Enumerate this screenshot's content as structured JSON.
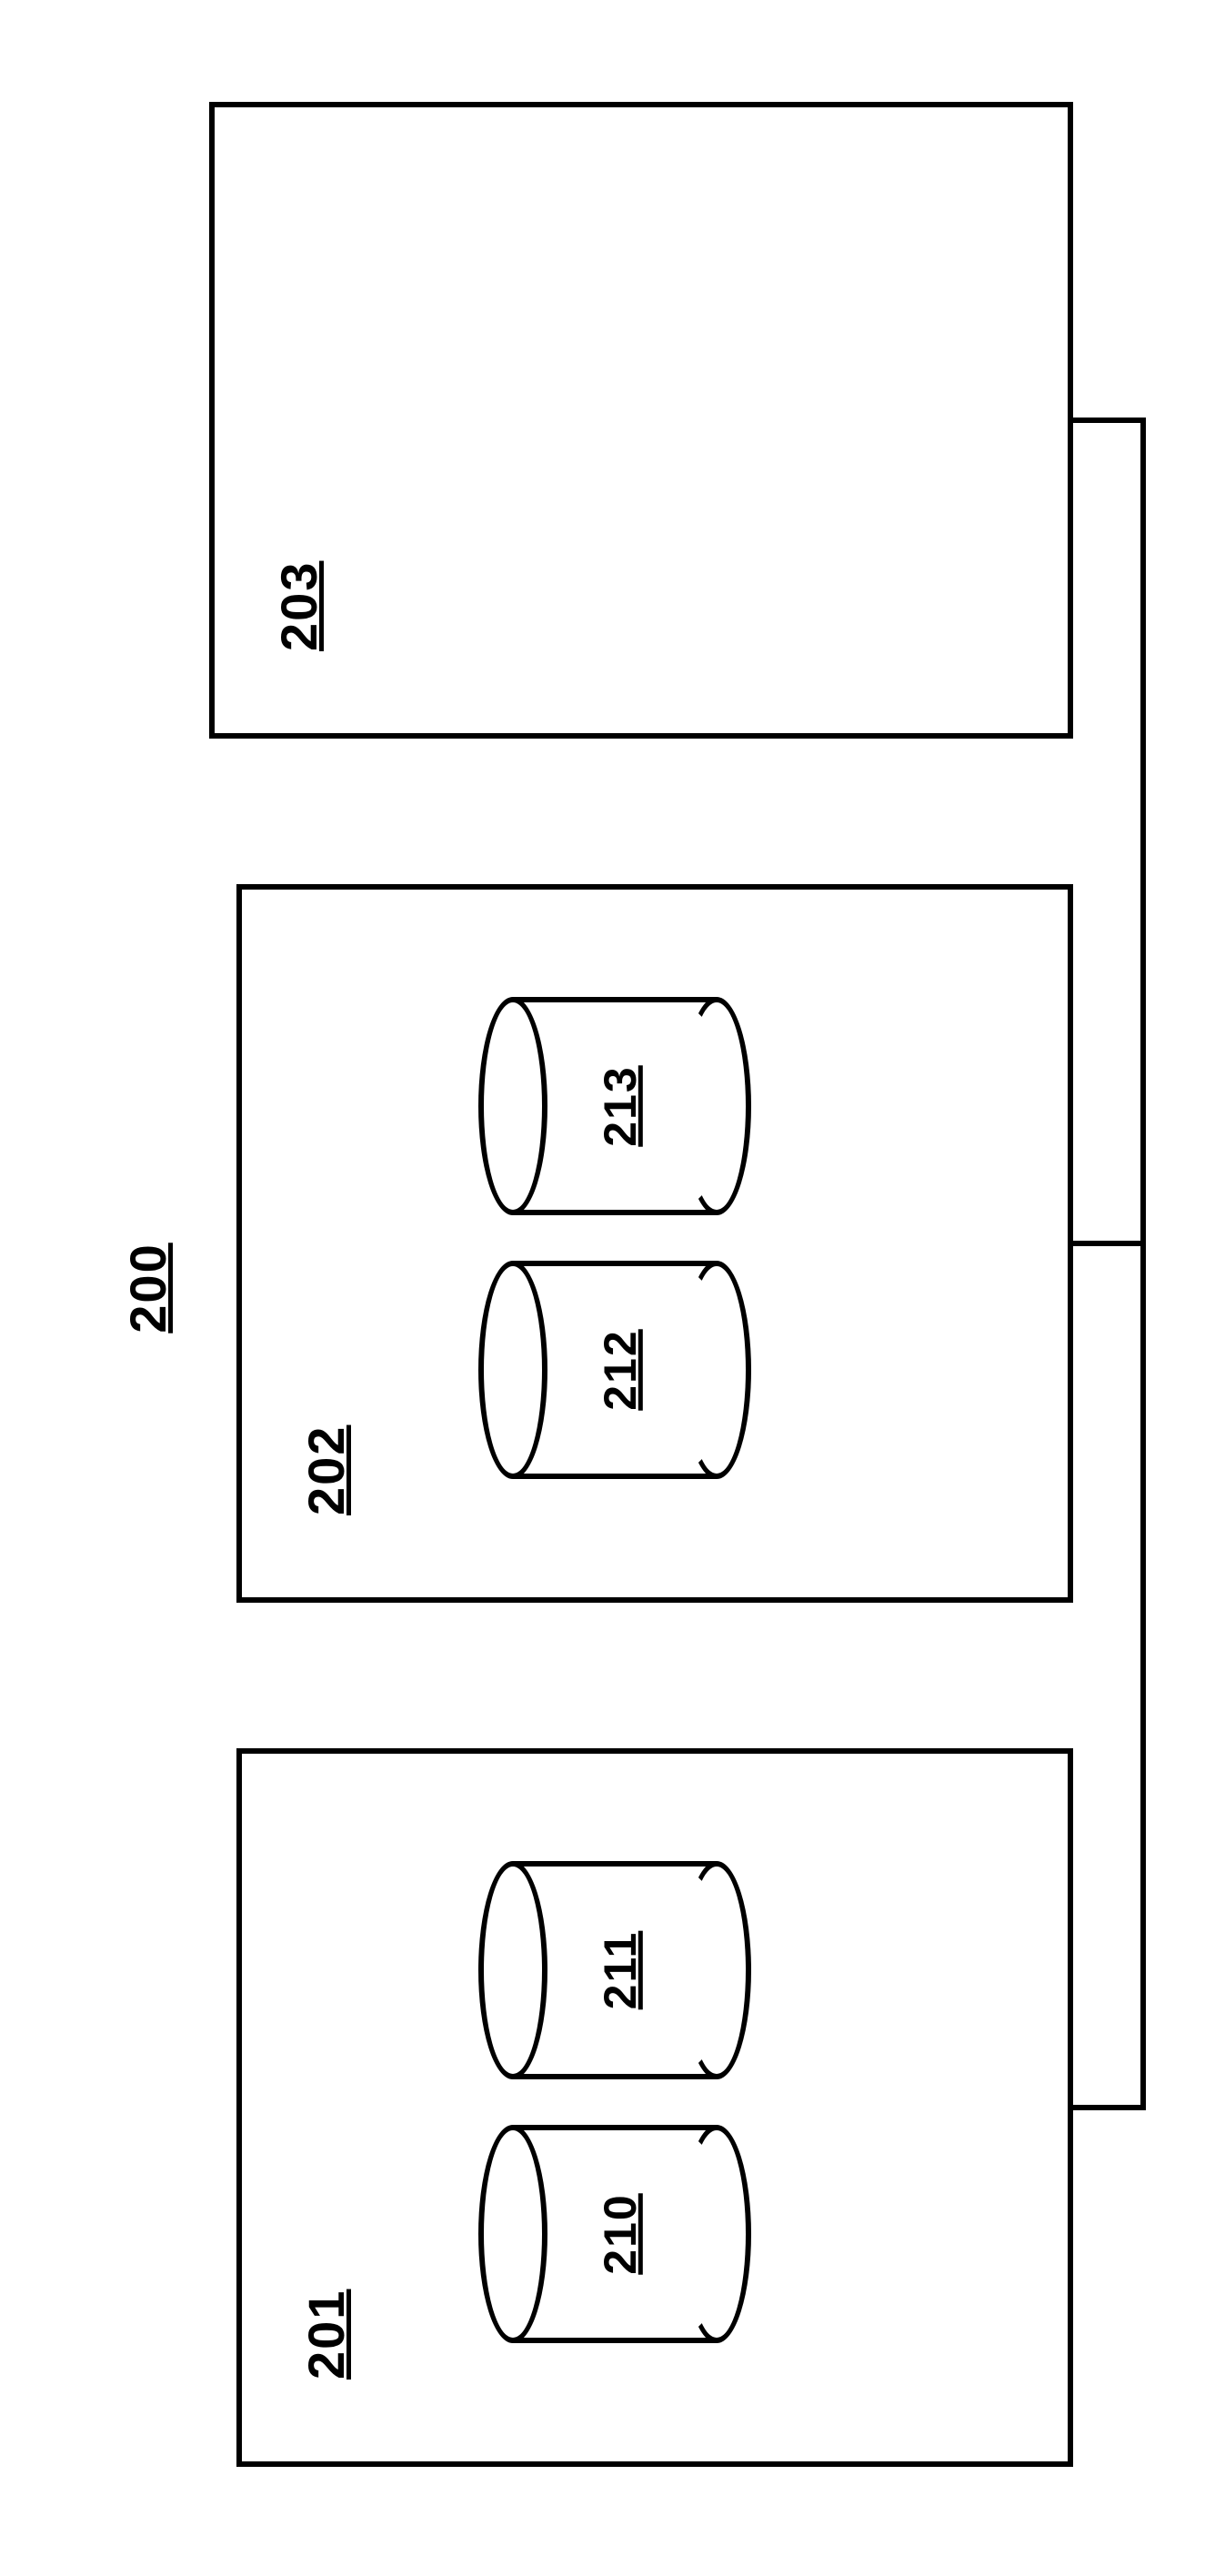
{
  "diagram": {
    "title": "200",
    "box_left": {
      "label": "201"
    },
    "box_middle": {
      "label": "202"
    },
    "box_right": {
      "label": "203"
    },
    "cylinders": {
      "c210": {
        "label": "210"
      },
      "c211": {
        "label": "211"
      },
      "c212": {
        "label": "212"
      },
      "c213": {
        "label": "213"
      }
    }
  }
}
